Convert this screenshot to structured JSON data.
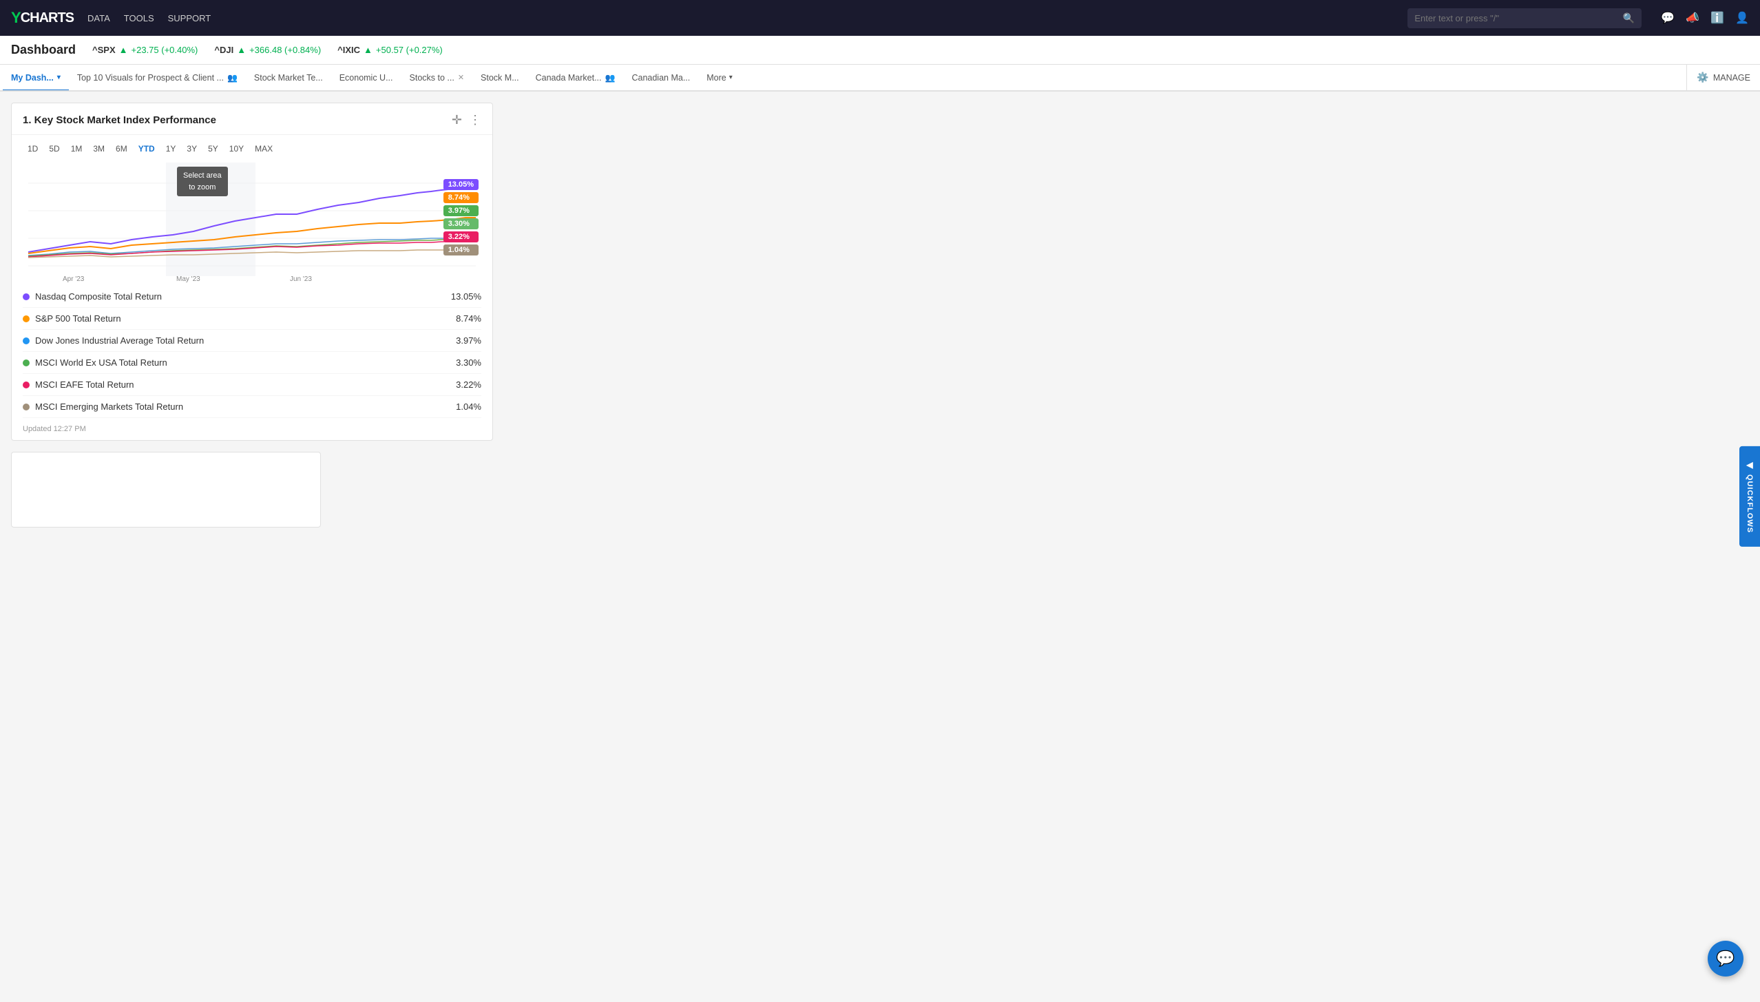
{
  "logo": {
    "y": "Y",
    "charts": "CHARTS"
  },
  "nav": {
    "links": [
      "DATA",
      "TOOLS",
      "SUPPORT"
    ],
    "search_placeholder": "Enter text or press \"/\""
  },
  "ticker_bar": {
    "title": "Dashboard",
    "tickers": [
      {
        "name": "^SPX",
        "value": "+23.75 (+0.40%)"
      },
      {
        "name": "^DJI",
        "value": "+366.48 (+0.84%)"
      },
      {
        "name": "^IXIC",
        "value": "+50.57 (+0.27%)"
      }
    ]
  },
  "tabs": [
    {
      "label": "My Dash...",
      "active": true,
      "closable": false,
      "has_users": false,
      "has_dropdown": true
    },
    {
      "label": "Top 10 Visuals for Prospect & Client ...",
      "active": false,
      "closable": false,
      "has_users": true
    },
    {
      "label": "Stock Market Te...",
      "active": false,
      "closable": false,
      "has_users": false
    },
    {
      "label": "Economic U...",
      "active": false,
      "closable": false,
      "has_users": false
    },
    {
      "label": "Stocks to ...",
      "active": false,
      "closable": true,
      "has_users": false
    },
    {
      "label": "Stock M...",
      "active": false,
      "closable": false,
      "has_users": false
    },
    {
      "label": "Canada Market...",
      "active": false,
      "closable": false,
      "has_users": true
    },
    {
      "label": "Canadian Ma...",
      "active": false,
      "closable": false,
      "has_users": false
    }
  ],
  "tabs_more": "More",
  "manage": "MANAGE",
  "chart": {
    "title": "1. Key Stock Market Index Performance",
    "time_filters": [
      "1D",
      "5D",
      "1M",
      "3M",
      "6M",
      "YTD",
      "1Y",
      "3Y",
      "5Y",
      "10Y",
      "MAX"
    ],
    "active_filter": "YTD",
    "x_labels": [
      "Apr '23",
      "May '23",
      "Jun '23"
    ],
    "zoom_tooltip": "Select area\nto zoom",
    "series": [
      {
        "name": "Nasdaq Composite Total Return",
        "value": "13.05%",
        "color": "#7c4dff",
        "dot_color": "#7c4dff"
      },
      {
        "name": "S&P 500 Total Return",
        "value": "8.74%",
        "color": "#ff8c00",
        "dot_color": "#ff9800"
      },
      {
        "name": "Dow Jones Industrial Average Total Return",
        "value": "3.97%",
        "color": "#5b9bd5",
        "dot_color": "#2196f3"
      },
      {
        "name": "MSCI World Ex USA Total Return",
        "value": "3.30%",
        "color": "#70ad47",
        "dot_color": "#4caf50"
      },
      {
        "name": "MSCI EAFE Total Return",
        "value": "3.22%",
        "color": "#ed7d31",
        "dot_color": "#e91e63"
      },
      {
        "name": "MSCI Emerging Markets Total Return",
        "value": "1.04%",
        "color": "#c8aa80",
        "dot_color": "#a0907a"
      }
    ],
    "tag_colors": [
      "#7c4dff",
      "#ff8c00",
      "#4caf50",
      "#66bb6a",
      "#e91e63",
      "#a0907a"
    ],
    "updated": "Updated 12:27 PM"
  },
  "quickflows": "QUICKFLOWS",
  "chat_icon": "💬"
}
